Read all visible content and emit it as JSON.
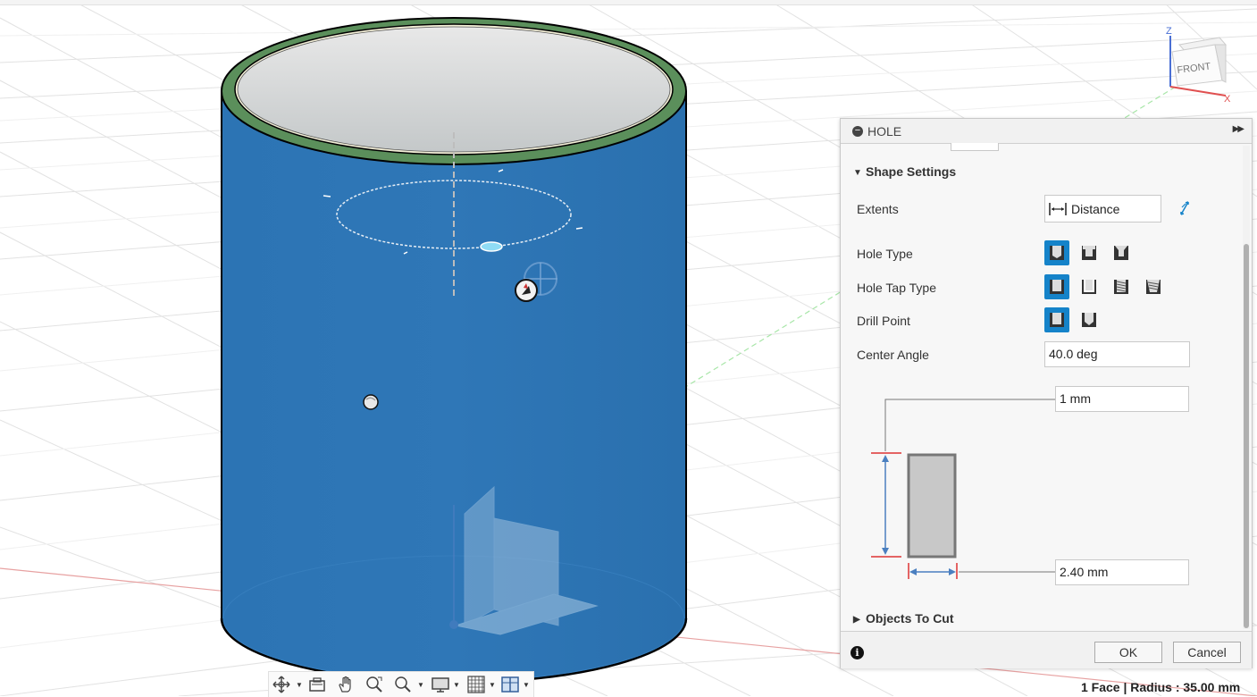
{
  "viewcube": {
    "face_label": "FRONT",
    "axis_z": "Z",
    "axis_x": "X"
  },
  "hole_panel": {
    "title": "HOLE",
    "shape_settings": {
      "section_title": "Shape Settings",
      "extents": {
        "label": "Extents",
        "value": "Distance"
      },
      "hole_type": {
        "label": "Hole Type",
        "options": [
          "simple-hole",
          "counterbore-hole",
          "countersink-hole"
        ],
        "selected": 0
      },
      "hole_tap_type": {
        "label": "Hole Tap Type",
        "options": [
          "simple-tap",
          "clearance-tap",
          "tapped",
          "taper-tapped"
        ],
        "selected": 0
      },
      "drill_point": {
        "label": "Drill Point",
        "options": [
          "flat-drill-point",
          "angled-drill-point"
        ],
        "selected": 0
      },
      "center_angle": {
        "label": "Center Angle",
        "value": "40.0 deg"
      },
      "depth": {
        "value": "1 mm"
      },
      "diameter": {
        "value": "2.40 mm"
      }
    },
    "objects_to_cut": {
      "section_title": "Objects To Cut"
    },
    "footer": {
      "ok_label": "OK",
      "cancel_label": "Cancel"
    }
  },
  "status_bar": {
    "text": "1 Face | Radius : 35.00 mm"
  },
  "navigation_toolbar": {
    "tools": [
      "orbit-icon",
      "look-at-icon",
      "pan-icon",
      "zoom-window-icon",
      "zoom-icon",
      "display-settings-icon",
      "grid-icon",
      "viewports-icon"
    ]
  },
  "colors": {
    "body": "#2a73b3",
    "rim": "#5b8f5b",
    "accent": "#1583c9",
    "axis_x": "#e06060",
    "axis_y": "#60d060"
  }
}
